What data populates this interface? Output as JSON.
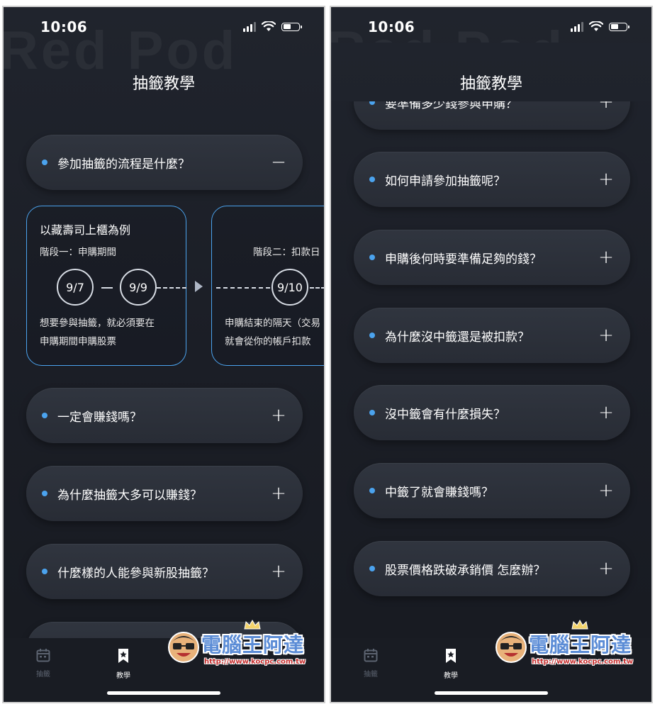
{
  "status_bar": {
    "time": "10:06"
  },
  "watermark": {
    "text": "Red Pod"
  },
  "header": {
    "title": "抽籤教學"
  },
  "left_screen": {
    "expanded_question": "參加抽籤的流程是什麼？",
    "expanded_toggle": "−",
    "steps": {
      "example_title": "以藏壽司上櫃為例",
      "stage1_label": "階段一：申購期間",
      "stage1_dates": [
        "9/7",
        "9/9"
      ],
      "stage1_desc": [
        "想要參與抽籤，就必須要在",
        "申購期間申購股票"
      ],
      "stage2_label": "階段二：扣款日",
      "stage2_date": "9/10",
      "stage2_desc": [
        "申購結束的隔天（交易",
        "就會從你的帳戶扣款"
      ]
    },
    "questions": [
      "一定會賺錢嗎？",
      "為什麼抽籤大多可以賺錢？",
      "什麼樣的人能參與新股抽籤？"
    ]
  },
  "right_screen": {
    "partial_question": "要準備多少錢參與申購？",
    "questions": [
      "如何申請參加抽籤呢？",
      "申購後何時要準備足夠的錢？",
      "為什麼沒中籤還是被扣款？",
      "沒中籤會有什麼損失？",
      "中籤了就會賺錢嗎？",
      "股票價格跌破承銷價 怎麼辦？"
    ]
  },
  "collapsed_toggle": "+",
  "tab_bar": {
    "tabs": [
      {
        "label": "抽籤",
        "icon": "calendar-icon",
        "active": false
      },
      {
        "label": "教學",
        "icon": "bookmark-star-icon",
        "active": true
      }
    ]
  },
  "logo_watermark": {
    "name": "電腦王阿達",
    "url": "http://www.kocpc.com.tw"
  },
  "colors": {
    "accent": "#4ba3ee",
    "background": "#1b1e26",
    "card": "#2c3039",
    "text": "#ffffff"
  }
}
